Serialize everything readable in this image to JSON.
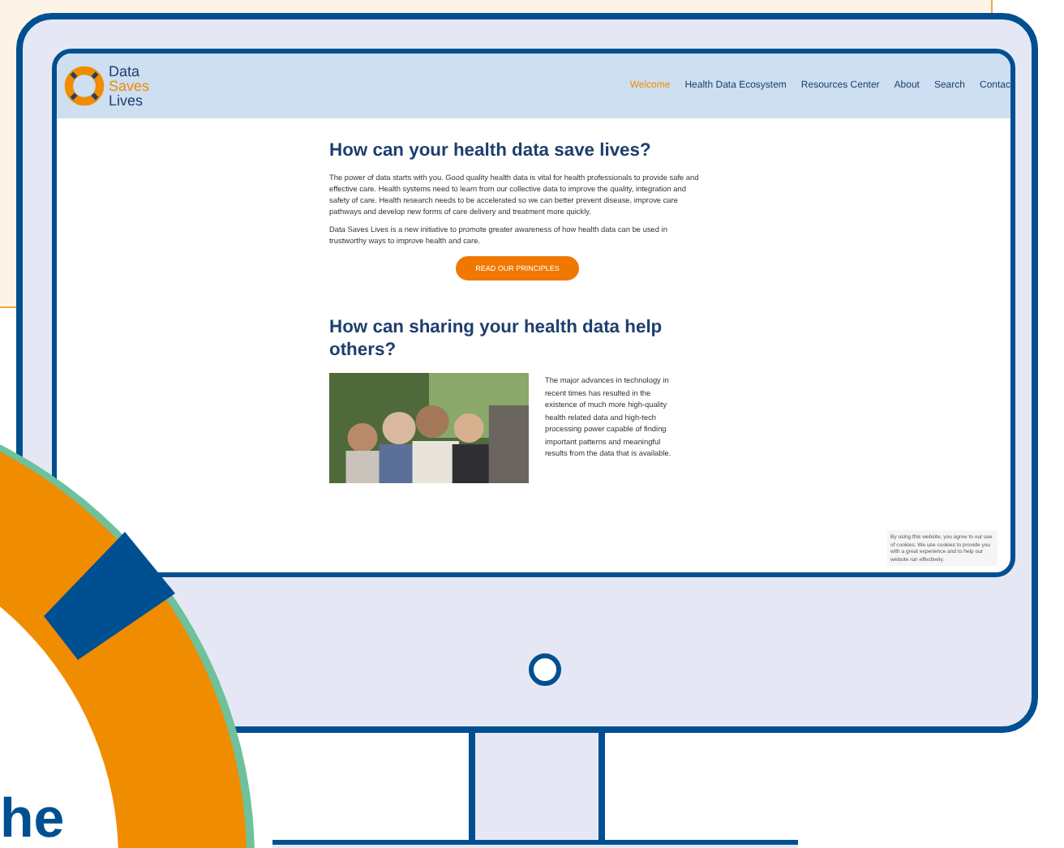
{
  "logo": {
    "lines": [
      "Data",
      "Saves",
      "Lives"
    ]
  },
  "nav": [
    {
      "label": "Welcome",
      "selected": true
    },
    {
      "label": "Health Data Ecosystem",
      "selected": false
    },
    {
      "label": "Resources Center",
      "selected": false
    },
    {
      "label": "About",
      "selected": false
    },
    {
      "label": "Search",
      "selected": false
    },
    {
      "label": "Contac",
      "selected": false
    }
  ],
  "intro": {
    "heading": "How can your health data save lives?",
    "paragraphs": [
      "The power of data starts with you. Good quality health data is vital for health professionals to provide safe and effective care. Health systems need to learn from our collective data to improve the quality, integration and safety of care. Health research needs to be accelerated so we can better prevent disease, improve care pathways and develop new forms of care delivery and treatment more quickly.",
      "Data Saves Lives is a new initiative to promote greater awareness of how health data can be used in trustworthy ways to improve health and care."
    ],
    "button": "READ OUR PRINCIPLES"
  },
  "sharing": {
    "heading": "How can sharing your health data help others?",
    "text": "The major advances in technology in recent times has resulted in the existence of much more high-quality health related data and high-tech processing power capable of finding important patterns and meaningful results from the data that is available."
  },
  "cookie_notice": "By using this website, you agree to our use of cookies. We use cookies to provide you with a great experience and to help our website run effectively.",
  "side_heading": "he"
}
